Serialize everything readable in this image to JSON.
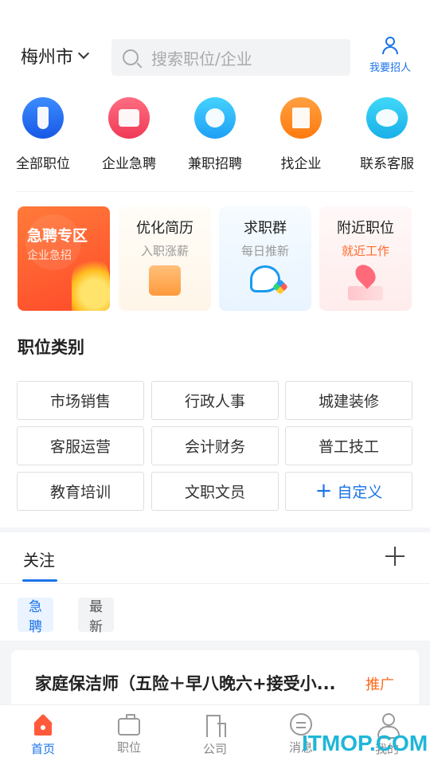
{
  "header": {
    "city": "梅州市",
    "search_placeholder": "搜索职位/企业",
    "recruit_label": "我要招人"
  },
  "quick_links": [
    {
      "label": "全部职位",
      "icon": "tie-icon",
      "color": "#2a6ff0"
    },
    {
      "label": "企业急聘",
      "icon": "urgent-bag-icon",
      "color": "#f24a62"
    },
    {
      "label": "兼职招聘",
      "icon": "compass-icon",
      "color": "#2aa8f8"
    },
    {
      "label": "找企业",
      "icon": "book-icon",
      "color": "#ff8a1a"
    },
    {
      "label": "联系客服",
      "icon": "chat-bubble-icon",
      "color": "#22bdf0"
    }
  ],
  "feature_cards": {
    "urgent": {
      "title": "急聘专区",
      "subtitle": "企业急招"
    },
    "resume": {
      "title": "优化简历",
      "subtitle": "入职涨薪"
    },
    "group": {
      "title": "求职群",
      "subtitle": "每日推新"
    },
    "nearby": {
      "title": "附近职位",
      "subtitle": "就近工作"
    }
  },
  "categories": {
    "title": "职位类别",
    "items": [
      "市场销售",
      "行政人事",
      "城建装修",
      "客服运营",
      "会计财务",
      "普工技工",
      "教育培训",
      "文职文员"
    ],
    "custom_label": "自定义"
  },
  "follow": {
    "tab_label": "关注",
    "filters": [
      "急聘",
      "最新"
    ]
  },
  "job_list": [
    {
      "title": "家庭保洁师（五险＋早八晚六+接受小...",
      "tag": "推广"
    }
  ],
  "bottom_nav": [
    {
      "label": "首页",
      "icon": "home-icon",
      "active": true
    },
    {
      "label": "职位",
      "icon": "briefcase-icon",
      "active": false
    },
    {
      "label": "公司",
      "icon": "building-icon",
      "active": false
    },
    {
      "label": "消息",
      "icon": "message-icon",
      "active": false
    },
    {
      "label": "我的",
      "icon": "user-icon",
      "active": false
    }
  ],
  "watermark": "ITMOP.COM",
  "colors": {
    "accent": "#1a73e8",
    "promo": "#ff6a1a",
    "urgent": "#ff5a3a"
  }
}
